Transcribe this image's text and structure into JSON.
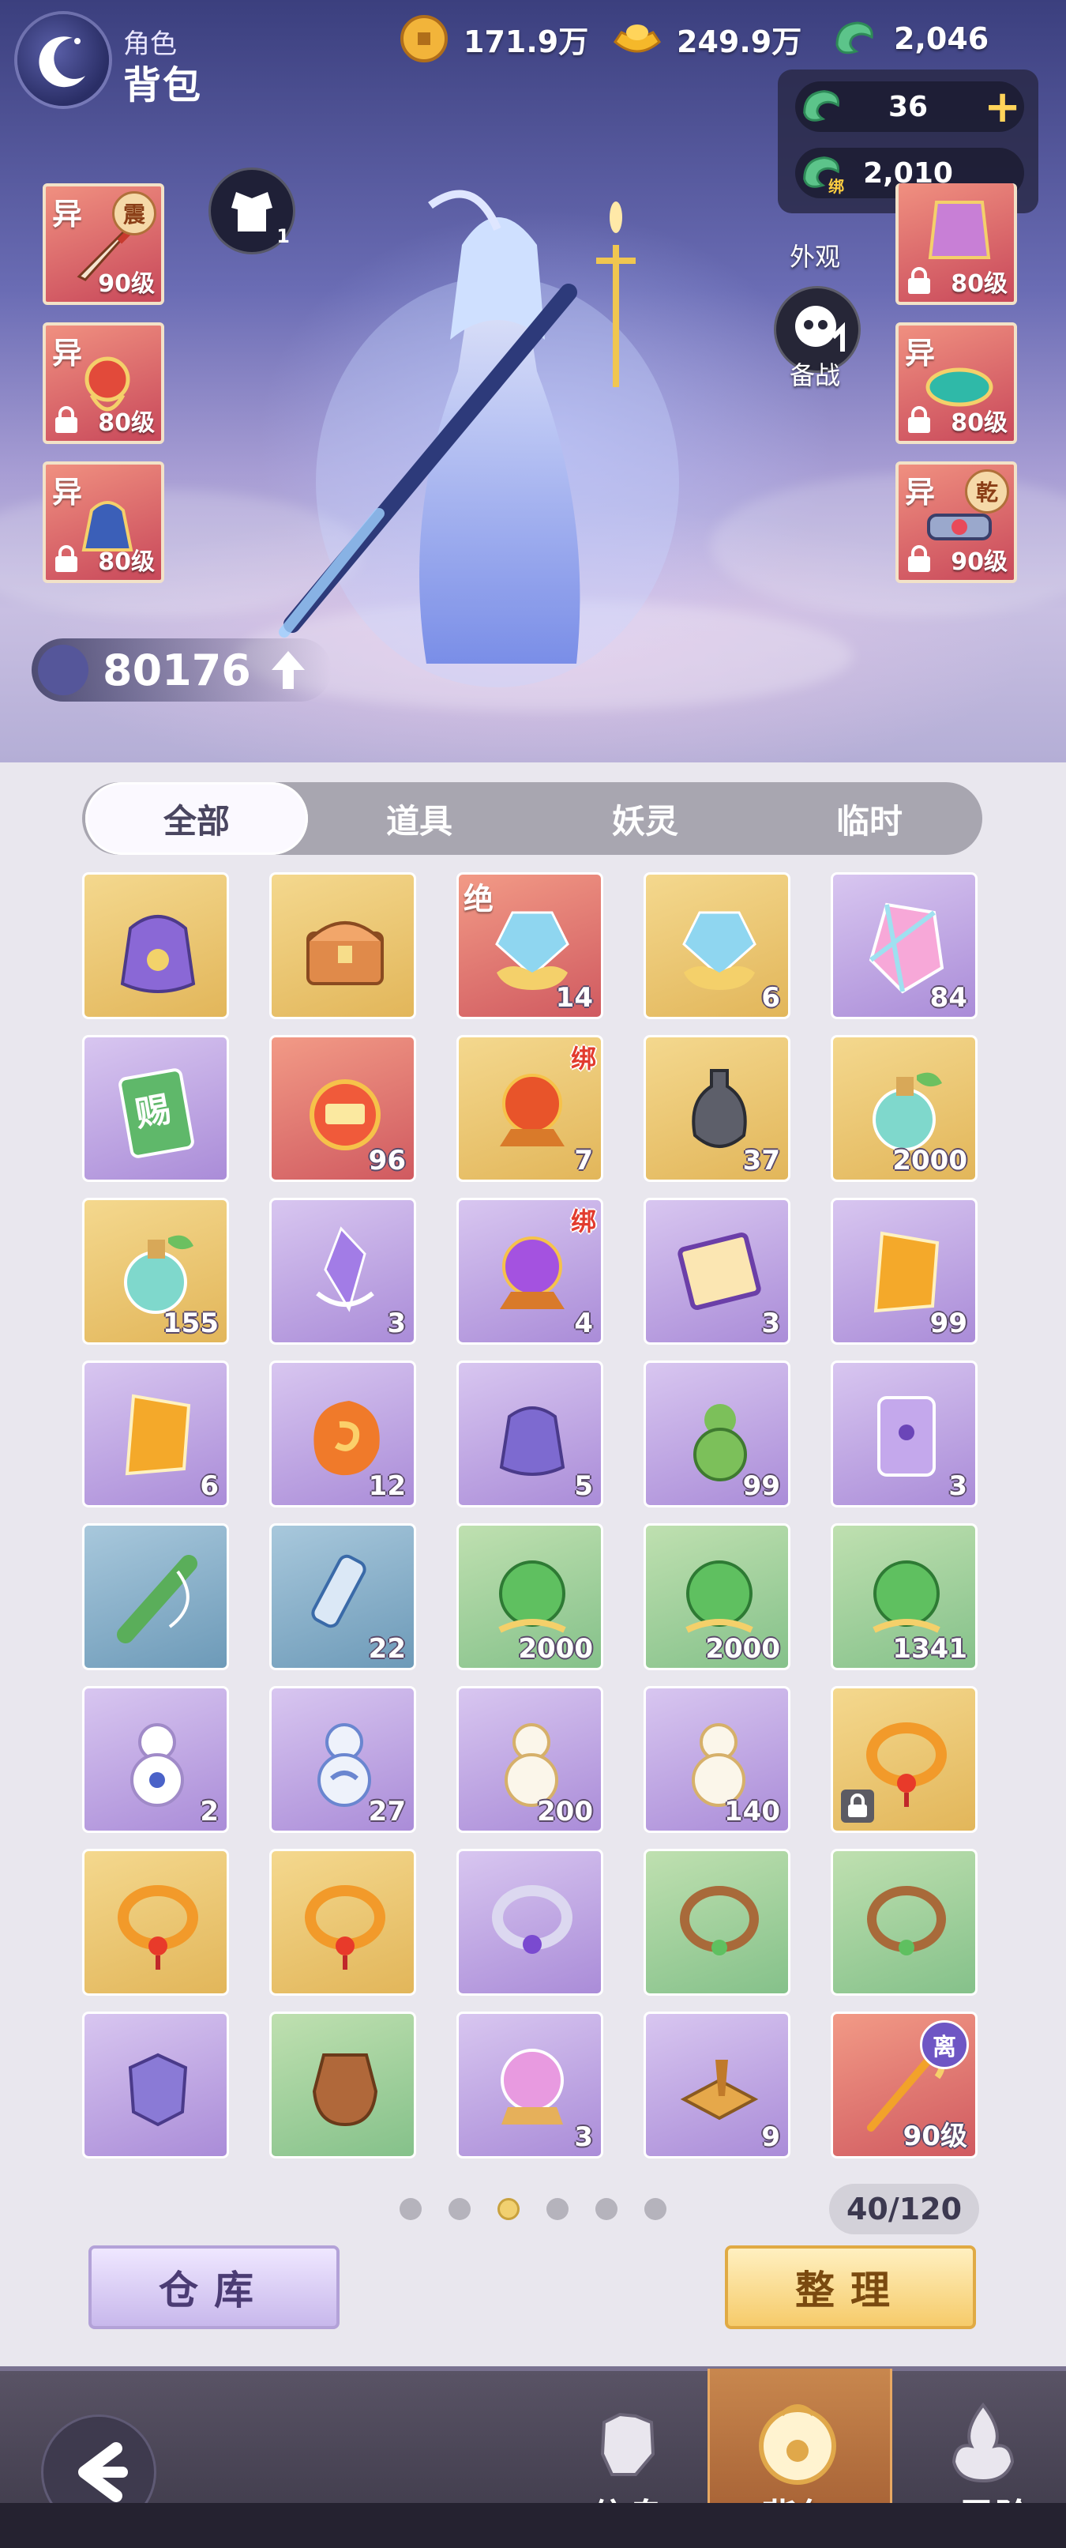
{
  "header": {
    "category": "角色",
    "title": "背包"
  },
  "resources": [
    {
      "name": "coin-icon",
      "value": "171.9万"
    },
    {
      "name": "gold-ingot-icon",
      "value": "249.9万"
    },
    {
      "name": "jade-dragon-icon",
      "value": "2,046"
    }
  ],
  "jade_popup": {
    "rows": [
      {
        "value": "36",
        "add": "+"
      },
      {
        "value": "2,010",
        "bind": "绑"
      }
    ]
  },
  "equipment": {
    "left": [
      {
        "tag": "异",
        "level": "90级",
        "badge": "震",
        "locked": false
      },
      {
        "tag": "异",
        "level": "80级",
        "locked": true
      },
      {
        "tag": "异",
        "level": "80级",
        "locked": true
      }
    ],
    "right": [
      {
        "level": "80级",
        "locked": true
      },
      {
        "tag": "异",
        "level": "80级",
        "locked": true
      },
      {
        "tag": "异",
        "level": "90级",
        "badge": "乾",
        "locked": true
      }
    ],
    "armor_count": "1",
    "appearance_label": "外观",
    "battle_prep_label": "备战"
  },
  "power": {
    "value": "80176"
  },
  "tabs": [
    {
      "label": "全部",
      "active": true
    },
    {
      "label": "道具",
      "active": false
    },
    {
      "label": "妖灵",
      "active": false
    },
    {
      "label": "临时",
      "active": false
    }
  ],
  "items": [
    {
      "icon": "pouch-icon",
      "rarity": "gold",
      "count": ""
    },
    {
      "icon": "treasure-chest-icon",
      "rarity": "gold",
      "count": ""
    },
    {
      "icon": "crystal-cloud-icon",
      "rarity": "red",
      "count": "14",
      "tag": "绝"
    },
    {
      "icon": "crystal-cloud-icon",
      "rarity": "gold",
      "count": "6"
    },
    {
      "icon": "rainbow-gem-icon",
      "rarity": "purple",
      "count": "84"
    },
    {
      "icon": "gift-card-icon",
      "rarity": "purple",
      "count": "",
      "card_text": "赐"
    },
    {
      "icon": "pocket-watch-icon",
      "rarity": "red",
      "count": "96"
    },
    {
      "icon": "red-orb-icon",
      "rarity": "gold",
      "count": "7",
      "bind": "绑"
    },
    {
      "icon": "black-vase-icon",
      "rarity": "gold",
      "count": "37"
    },
    {
      "icon": "potion-bottle-icon",
      "rarity": "gold",
      "count": "2000"
    },
    {
      "icon": "potion-bottle-icon",
      "rarity": "gold",
      "count": "155"
    },
    {
      "icon": "purple-crystal-icon",
      "rarity": "purple",
      "count": "3"
    },
    {
      "icon": "purple-orb-icon",
      "rarity": "purple",
      "count": "4",
      "bind": "绑"
    },
    {
      "icon": "scroll-card-icon",
      "rarity": "purple",
      "count": "3"
    },
    {
      "icon": "amber-stone-icon",
      "rarity": "purple",
      "count": "99"
    },
    {
      "icon": "amber-stone-icon",
      "rarity": "purple",
      "count": "6"
    },
    {
      "icon": "swirl-stone-icon",
      "rarity": "purple",
      "count": "12"
    },
    {
      "icon": "purple-pouch-icon",
      "rarity": "purple",
      "count": "5"
    },
    {
      "icon": "green-gourd-icon",
      "rarity": "purple",
      "count": "99"
    },
    {
      "icon": "scroll-icon",
      "rarity": "purple",
      "count": "3"
    },
    {
      "icon": "bamboo-flute-icon",
      "rarity": "blue",
      "count": ""
    },
    {
      "icon": "scroll-tube-icon",
      "rarity": "blue",
      "count": "22"
    },
    {
      "icon": "green-orb-icon",
      "rarity": "green",
      "count": "2000"
    },
    {
      "icon": "green-orb-icon",
      "rarity": "green",
      "count": "2000"
    },
    {
      "icon": "green-orb-icon",
      "rarity": "green",
      "count": "1341"
    },
    {
      "icon": "gourd-icon",
      "rarity": "purple",
      "count": "2"
    },
    {
      "icon": "blue-gourd-icon",
      "rarity": "purple",
      "count": "27"
    },
    {
      "icon": "white-gourd-icon",
      "rarity": "purple",
      "count": "200"
    },
    {
      "icon": "white-gourd-icon",
      "rarity": "purple",
      "count": "140"
    },
    {
      "icon": "gold-necklace-icon",
      "rarity": "gold",
      "count": "",
      "locked": true
    },
    {
      "icon": "gold-necklace-icon",
      "rarity": "gold",
      "count": ""
    },
    {
      "icon": "gold-necklace-icon",
      "rarity": "gold",
      "count": ""
    },
    {
      "icon": "silver-necklace-icon",
      "rarity": "purple",
      "count": ""
    },
    {
      "icon": "vine-necklace-icon",
      "rarity": "green",
      "count": ""
    },
    {
      "icon": "vine-necklace-icon",
      "rarity": "green",
      "count": ""
    },
    {
      "icon": "armor-piece-icon",
      "rarity": "purple",
      "count": ""
    },
    {
      "icon": "clay-jar-icon",
      "rarity": "green",
      "count": ""
    },
    {
      "icon": "pink-orb-icon",
      "rarity": "purple",
      "count": "3"
    },
    {
      "icon": "wooden-box-icon",
      "rarity": "purple",
      "count": "9"
    },
    {
      "icon": "staff-weapon-icon",
      "rarity": "red",
      "count": "90级",
      "li": "离"
    }
  ],
  "pagination": {
    "total_pages": 6,
    "current_page": 3
  },
  "capacity": "40/120",
  "buttons": {
    "warehouse": "仓库",
    "sort": "整理"
  },
  "nav": [
    {
      "label": "信息",
      "icon": "fist-icon"
    },
    {
      "label": "背包",
      "icon": "bag-icon",
      "active": true
    },
    {
      "label": "灵阶",
      "icon": "flame-icon"
    }
  ]
}
